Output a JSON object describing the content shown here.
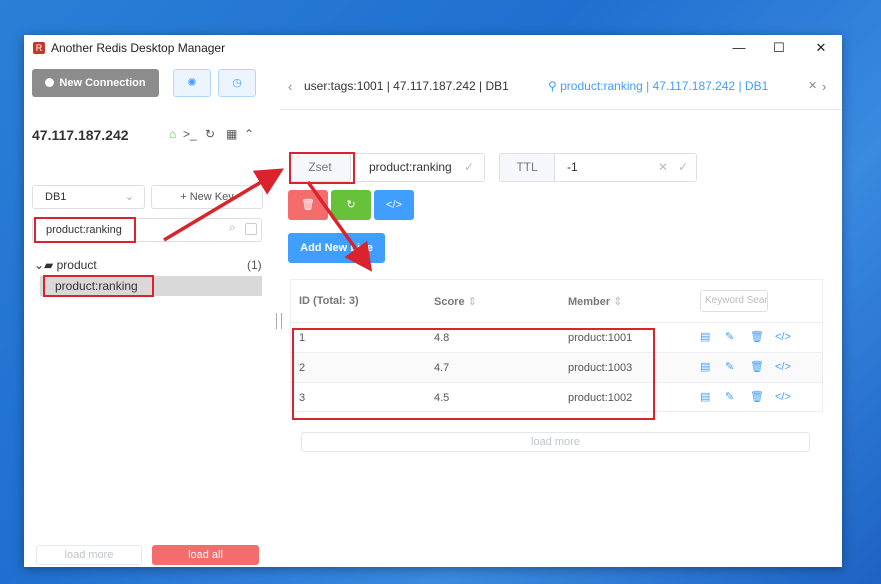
{
  "window": {
    "title": "Another Redis Desktop Manager",
    "minimize": "—",
    "maximize": "☐",
    "close": "✕"
  },
  "sidebar": {
    "new_connection": "New Connection",
    "server": "47.117.187.242",
    "db": "DB1",
    "new_key": "+ New Key",
    "filter_value": "product:ranking",
    "folder": {
      "name": "product",
      "count": "(1)"
    },
    "leaf": "product:ranking",
    "load_more": "load more",
    "load_all": "load all"
  },
  "tabs": [
    {
      "label": "user:tags:1001 | 47.117.187.242 | DB1"
    },
    {
      "label": "product:ranking | 47.117.187.242 | DB1",
      "active": true
    }
  ],
  "key": {
    "type": "Zset",
    "name": "product:ranking",
    "ttl_label": "TTL",
    "ttl": "-1"
  },
  "actions": {
    "add_line": "Add New Line"
  },
  "table": {
    "columns": [
      "ID (Total: 3)",
      "Score",
      "Member"
    ],
    "keyword_placeholder": "Keyword Search",
    "rows": [
      {
        "id": "1",
        "score": "4.8",
        "member": "product:1001"
      },
      {
        "id": "2",
        "score": "4.7",
        "member": "product:1003"
      },
      {
        "id": "3",
        "score": "4.5",
        "member": "product:1002"
      }
    ],
    "load_more": "load more"
  },
  "colors": {
    "primary": "#409eff",
    "danger": "#f56c6c",
    "success": "#67c23a",
    "highlight": "#d9232d"
  }
}
